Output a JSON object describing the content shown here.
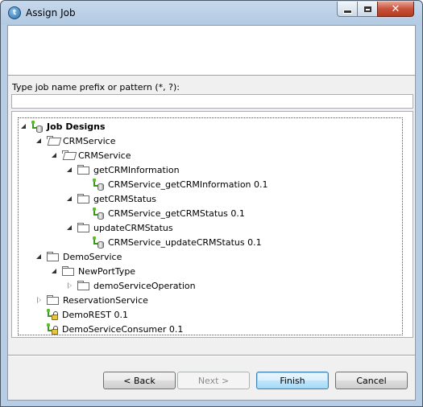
{
  "window": {
    "title": "Assign Job",
    "app_icon_glyph": "t"
  },
  "filter": {
    "label": "Type job name prefix or pattern (*, ?):",
    "value": ""
  },
  "tree": {
    "nodes": [
      {
        "label": "Job Designs",
        "icon": "job-designs-icon",
        "expanded": true
      },
      {
        "label": "CRMService",
        "icon": "folder-open-icon",
        "expanded": true
      },
      {
        "label": "CRMService",
        "icon": "folder-open-icon",
        "expanded": true
      },
      {
        "label": "getCRMInformation",
        "icon": "folder-icon",
        "expanded": true
      },
      {
        "label": "CRMService_getCRMInformation 0.1",
        "icon": "job-icon"
      },
      {
        "label": "getCRMStatus",
        "icon": "folder-icon",
        "expanded": true
      },
      {
        "label": "CRMService_getCRMStatus 0.1",
        "icon": "job-icon"
      },
      {
        "label": "updateCRMStatus",
        "icon": "folder-icon",
        "expanded": true
      },
      {
        "label": "CRMService_updateCRMStatus 0.1",
        "icon": "job-icon"
      },
      {
        "label": "DemoService",
        "icon": "folder-icon",
        "expanded": true
      },
      {
        "label": "NewPortType",
        "icon": "folder-icon",
        "expanded": true
      },
      {
        "label": "demoServiceOperation",
        "icon": "folder-icon",
        "expanded": false
      },
      {
        "label": "ReservationService",
        "icon": "folder-icon",
        "expanded": false
      },
      {
        "label": "DemoREST 0.1",
        "icon": "locked-job-icon"
      },
      {
        "label": "DemoServiceConsumer 0.1",
        "icon": "locked-job-icon"
      }
    ]
  },
  "buttons": {
    "back": "< Back",
    "next": "Next >",
    "finish": "Finish",
    "cancel": "Cancel"
  },
  "colors": {
    "title_bar": "#b9d1ea",
    "close_button": "#c7503a",
    "default_button_border": "#3c7fb1"
  }
}
